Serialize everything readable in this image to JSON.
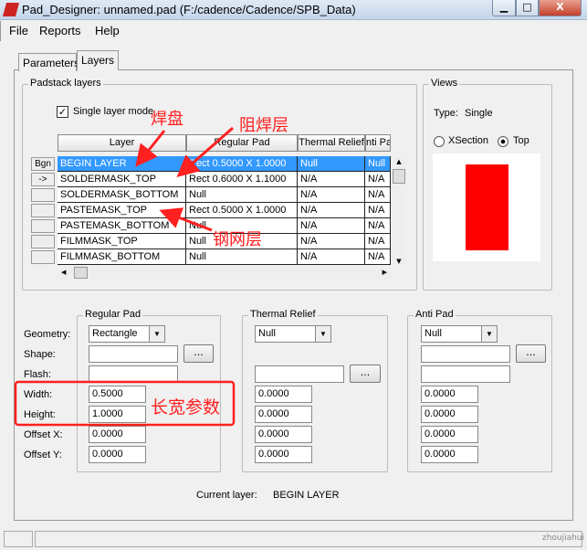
{
  "window": {
    "title": "Pad_Designer: unnamed.pad (F:/cadence/Cadence/SPB_Data)",
    "minimize": "▁",
    "maximize": "□",
    "close": "X"
  },
  "menu": [
    "File",
    "Reports",
    "Help"
  ],
  "tabs": [
    "Parameters",
    "Layers"
  ],
  "padstack": {
    "group": "Padstack layers",
    "single_layer_mode": "Single layer mode",
    "headers": [
      "Layer",
      "Regular Pad",
      "Thermal Relief",
      "nti Pa"
    ],
    "row_buttons": [
      "Bgn",
      "->",
      "",
      "",
      "",
      "",
      ""
    ],
    "rows": [
      [
        "BEGIN LAYER",
        "Rect 0.5000 X 1.0000",
        "Null",
        "Null"
      ],
      [
        "SOLDERMASK_TOP",
        "Rect 0.6000 X 1.1000",
        "N/A",
        "N/A"
      ],
      [
        "SOLDERMASK_BOTTOM",
        "Null",
        "N/A",
        "N/A"
      ],
      [
        "PASTEMASK_TOP",
        "Rect 0.5000 X 1.0000",
        "N/A",
        "N/A"
      ],
      [
        "PASTEMASK_BOTTOM",
        "Null",
        "N/A",
        "N/A"
      ],
      [
        "FILMMASK_TOP",
        "Null",
        "N/A",
        "N/A"
      ],
      [
        "FILMMASK_BOTTOM",
        "Null",
        "N/A",
        "N/A"
      ]
    ]
  },
  "views": {
    "group": "Views",
    "type_label": "Type:",
    "type_value": "Single",
    "xsection": "XSection",
    "top": "Top",
    "selected": "Top",
    "pad_color": "#ff0000"
  },
  "labels": {
    "geometry": "Geometry:",
    "shape": "Shape:",
    "flash": "Flash:",
    "width": "Width:",
    "height": "Height:",
    "offset_x": "Offset X:",
    "offset_y": "Offset Y:"
  },
  "regular": {
    "group": "Regular Pad",
    "geometry": "Rectangle",
    "width": "0.5000",
    "height": "1.0000",
    "offset_x": "0.0000",
    "offset_y": "0.0000"
  },
  "thermal": {
    "group": "Thermal Relief",
    "geometry": "Null",
    "width": "0.0000",
    "height": "0.0000",
    "offset_x": "0.0000",
    "offset_y": "0.0000"
  },
  "anti": {
    "group": "Anti Pad",
    "geometry": "Null",
    "width": "0.0000",
    "height": "0.0000",
    "offset_x": "0.0000",
    "offset_y": "0.0000"
  },
  "browse": "...",
  "current_layer": {
    "label": "Current layer:",
    "value": "BEGIN LAYER"
  },
  "annotations": {
    "pad": "焊盘",
    "soldermask": "阻焊层",
    "pastemask": "钢网层",
    "dims": "长宽参数"
  },
  "watermark": "zhoujiahui"
}
